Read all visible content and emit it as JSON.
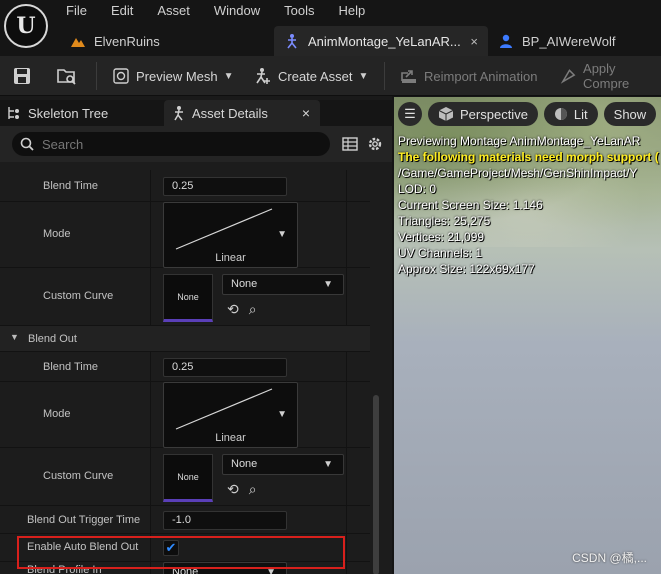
{
  "menu": [
    "File",
    "Edit",
    "Asset",
    "Window",
    "Tools",
    "Help"
  ],
  "doc_tabs": [
    {
      "label": "ElvenRuins"
    },
    {
      "label": "AnimMontage_YeLanAR...",
      "close": "×"
    },
    {
      "label": "BP_AIWereWolf"
    }
  ],
  "toolbar": {
    "preview_mesh": "Preview Mesh",
    "create_asset": "Create Asset",
    "reimport": "Reimport Animation",
    "apply_compression": "Apply Compre"
  },
  "panel_tabs": {
    "skeleton_tree": "Skeleton Tree",
    "asset_details": "Asset Details",
    "close": "×"
  },
  "search": {
    "placeholder": "Search"
  },
  "blend_in": {
    "blend_time_label": "Blend Time",
    "blend_time": "0.25",
    "mode_label": "Mode",
    "mode": "Linear",
    "curve_label": "Custom Curve",
    "curve_thumb": "None",
    "curve_value": "None"
  },
  "blend_out": {
    "category": "Blend Out",
    "blend_time_label": "Blend Time",
    "blend_time": "0.25",
    "mode_label": "Mode",
    "mode": "Linear",
    "curve_label": "Custom Curve",
    "curve_thumb": "None",
    "curve_value": "None"
  },
  "trigger": {
    "label": "Blend Out Trigger Time",
    "value": "-1.0"
  },
  "auto_blend": {
    "label": "Enable Auto Blend Out",
    "checked": true
  },
  "blend_profile": {
    "label": "Blend Profile In",
    "value": "None"
  },
  "viewport": {
    "perspective": "Perspective",
    "lit": "Lit",
    "show": "Show",
    "lines": [
      {
        "text": "Previewing Montage AnimMontage_YeLanAR",
        "style": "w"
      },
      {
        "text": "The following materials need morph support (",
        "style": "y"
      },
      {
        "text": "/Game/GameProject/Mesh/GenShinImpact/Y",
        "style": "w"
      },
      {
        "text": "LOD: 0",
        "style": "w"
      },
      {
        "text": "Current Screen Size: 1.146",
        "style": "w"
      },
      {
        "text": "Triangles: 25,275",
        "style": "w"
      },
      {
        "text": "Vertices: 21,099",
        "style": "w"
      },
      {
        "text": "UV Channels: 1",
        "style": "w"
      },
      {
        "text": "Approx Size: 122x69x177",
        "style": "w"
      }
    ],
    "watermark": "CSDN @橘,..."
  },
  "colors": {
    "accent": "#2f8bff",
    "highlight": "#d8201c",
    "curve_underline": "#5a3fb8",
    "warning": "#ffee22"
  }
}
